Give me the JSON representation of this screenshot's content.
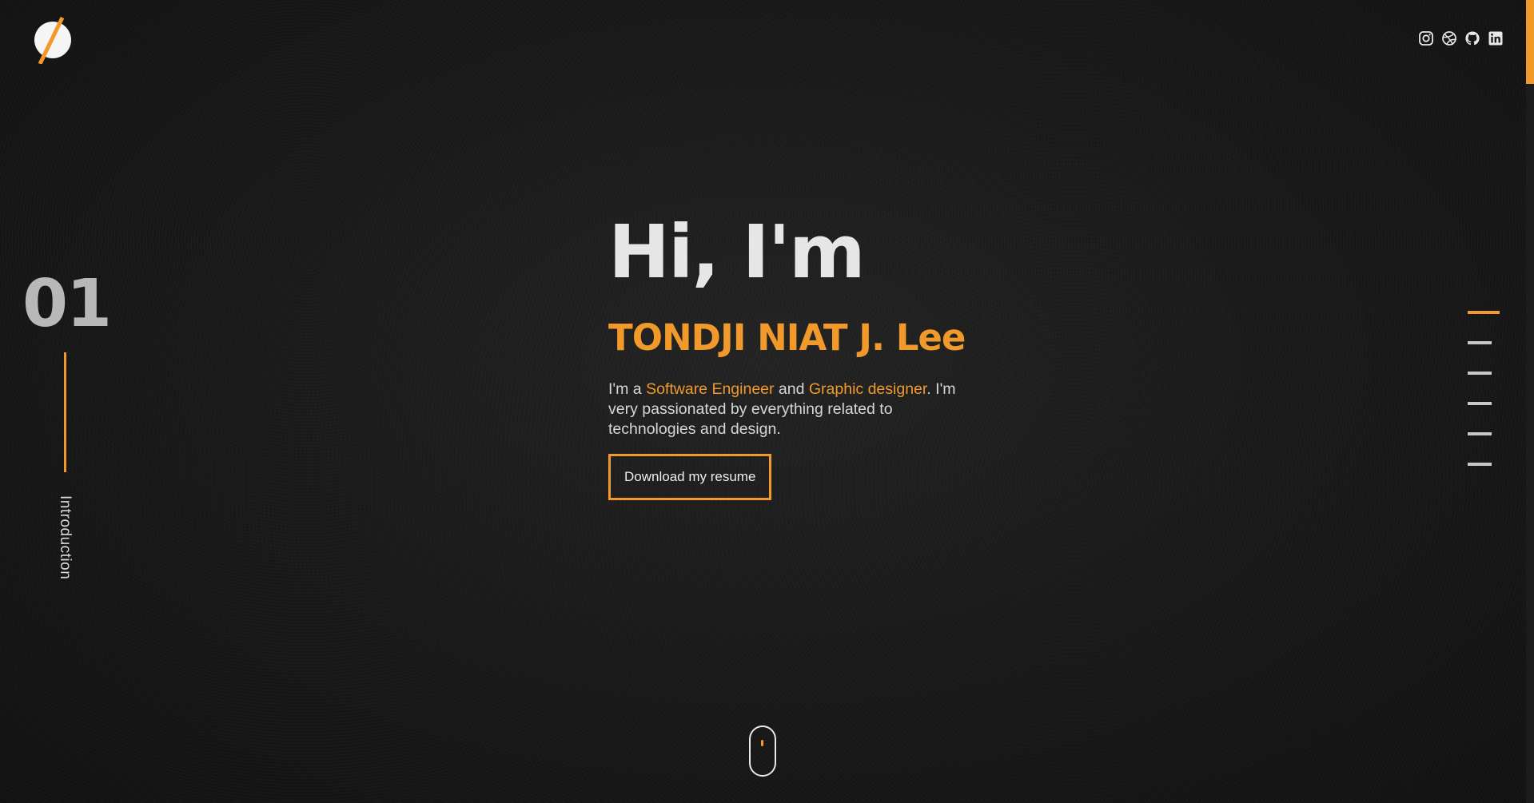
{
  "logo": {
    "icon": "logo-icon",
    "accent": "#f19a2b"
  },
  "social": [
    {
      "name": "instagram",
      "icon": "instagram-icon"
    },
    {
      "name": "dribbble",
      "icon": "dribbble-icon"
    },
    {
      "name": "github",
      "icon": "github-icon"
    },
    {
      "name": "linkedin",
      "icon": "linkedin-icon"
    }
  ],
  "section": {
    "number": "01",
    "label": "Introduction"
  },
  "hero": {
    "greeting": "Hi, I'm",
    "name": "TONDJI NIAT J. Lee",
    "bio": {
      "prefix": "I'm a ",
      "role1": "Software Engineer",
      "middle": " and ",
      "role2": "Graphic designer",
      "suffix": ". I'm very passionated by everything related to technologies and design."
    },
    "resume_button": "Download my resume"
  },
  "right_nav": {
    "count": 6,
    "active_index": 0
  },
  "colors": {
    "accent": "#f19a2b",
    "background": "#1a1a1a",
    "text": "#e6e6e6"
  }
}
